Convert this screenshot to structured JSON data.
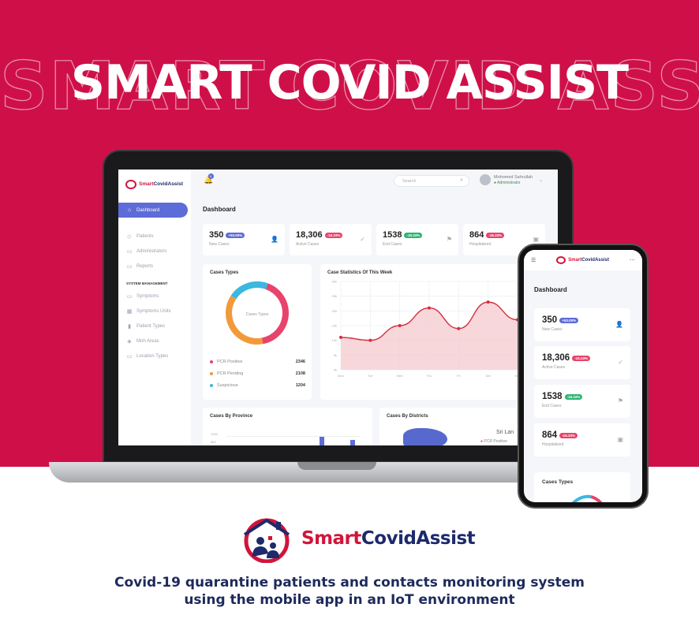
{
  "hero": {
    "title": "SMART COVID ASSIST"
  },
  "colors": {
    "brand_red": "#cf1048",
    "brand_navy": "#1d2a6b",
    "accent": "#5d6cd8",
    "pcr_positive": "#e8436b",
    "pcr_pending": "#f29a3a",
    "suspicious": "#3bb7e0",
    "green_badge": "#2bb673"
  },
  "desktop": {
    "brand_part1": "Smart",
    "brand_part2": "CovidAssist",
    "bell_count": "5",
    "search_placeholder": "Search",
    "user": {
      "name": "Mohomed Sahrullah",
      "role": "Administrator"
    },
    "sidebar": {
      "items": [
        {
          "label": "Dashboard",
          "icon": "home-icon"
        },
        {
          "label": "Patients",
          "icon": "tag-icon"
        },
        {
          "label": "Administrators",
          "icon": "document-icon"
        },
        {
          "label": "Reports",
          "icon": "document-icon"
        }
      ],
      "section_title": "SYSTEM MANAGEMENT",
      "system_items": [
        {
          "label": "Symptoms",
          "icon": "document-icon"
        },
        {
          "label": "Symptoms Units",
          "icon": "grid-icon"
        },
        {
          "label": "Patient Types",
          "icon": "bar-chart-icon"
        },
        {
          "label": "Moh Areas",
          "icon": "cube-icon"
        },
        {
          "label": "Location Types",
          "icon": "document-icon"
        }
      ]
    },
    "page_title": "Dashboard",
    "kpis": [
      {
        "value": "350",
        "badge": "+53.00%",
        "label": "New Cases",
        "badge_color": "#5d6cd8",
        "icon": "add-user-icon"
      },
      {
        "value": "18,306",
        "badge": "-16.33%",
        "label": "Active Cases",
        "badge_color": "#e8436b",
        "icon": "check-circle-icon"
      },
      {
        "value": "1538",
        "badge": "-16.33%",
        "label": "End Cases",
        "badge_color": "#2bb673",
        "icon": "flag-icon"
      },
      {
        "value": "864",
        "badge": "-16.33%",
        "label": "Hospitalized",
        "badge_color": "#e8436b",
        "icon": "hospital-icon"
      }
    ],
    "cases_types": {
      "title": "Cases Types",
      "center_label": "Cases Types",
      "legend": [
        {
          "label": "PCR Positive",
          "value": "2346",
          "color": "#e8436b"
        },
        {
          "label": "PCR Pending",
          "value": "2108",
          "color": "#f29a3a"
        },
        {
          "label": "Suspicious",
          "value": "1204",
          "color": "#3bb7e0"
        }
      ]
    },
    "stats_title": "Case Statistics Of This Week",
    "province_title": "Cases By Province",
    "province_tick_labels": [
      "1000",
      "800"
    ],
    "districts_title": "Cases By Districts",
    "districts_country": "Sri Lan",
    "districts_legend": "PCR Positive"
  },
  "chart_data": [
    {
      "type": "pie",
      "title": "Cases Types",
      "categories": [
        "PCR Positive",
        "PCR Pending",
        "Suspicious"
      ],
      "values": [
        2346,
        2108,
        1204
      ]
    },
    {
      "type": "line",
      "title": "Case Statistics Of This Week",
      "categories": [
        "Mon",
        "Tue",
        "Wed",
        "Thu",
        "Fri",
        "Sat",
        "Sun"
      ],
      "values": [
        11,
        10,
        15,
        21,
        14,
        23,
        17
      ],
      "ylim": [
        0,
        30
      ],
      "yticks": [
        "0k",
        "5k",
        "10k",
        "15k",
        "20k",
        "25k",
        "30k"
      ],
      "grid": true
    }
  ],
  "phone": {
    "brand_part1": "Smart",
    "brand_part2": "CovidAssist",
    "title": "Dashboard",
    "kpis": [
      {
        "value": "350",
        "badge": "+53.00%",
        "label": "New Cases",
        "badge_color": "#5d6cd8",
        "icon": "add-user-icon"
      },
      {
        "value": "18,306",
        "badge": "-16.33%",
        "label": "Active Cases",
        "badge_color": "#e8436b",
        "icon": "check-circle-icon"
      },
      {
        "value": "1538",
        "badge": "-16.33%",
        "label": "End Cases",
        "badge_color": "#2bb673",
        "icon": "flag-icon"
      },
      {
        "value": "864",
        "badge": "-16.33%",
        "label": "Hospitalized",
        "badge_color": "#e8436b",
        "icon": "hospital-icon"
      }
    ],
    "cases_types_title": "Cases Types"
  },
  "brand": {
    "name_part1": "Smart",
    "name_part2": "CovidAssist",
    "tagline_line1": "Covid-19 quarantine patients and contacts monitoring system",
    "tagline_line2": "using the mobile app in an IoT environment"
  }
}
